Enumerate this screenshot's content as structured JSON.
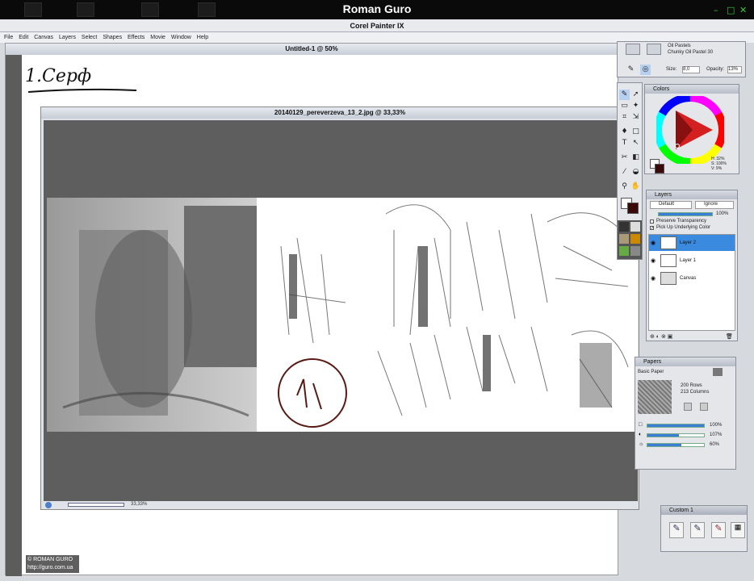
{
  "window": {
    "title": "Roman Guro",
    "controls": [
      "–",
      "□",
      "✕"
    ]
  },
  "app": {
    "title": "Corel Painter IX"
  },
  "menu": [
    "File",
    "Edit",
    "Canvas",
    "Layers",
    "Select",
    "Shapes",
    "Effects",
    "Movie",
    "Window",
    "Help"
  ],
  "doc1": {
    "title": "Untitled-1 @ 50%",
    "handwriting": "1.Серф"
  },
  "doc2": {
    "title": "20140129_pereverzeva_13_2.jpg @ 33,33%",
    "zoom": "33,33%"
  },
  "brush": {
    "category": "Oil Pastels",
    "variant": "Chunky Oil Pastel 30",
    "size_label": "Size:",
    "size": "8,0",
    "opacity_label": "Opacity:",
    "opacity": "13%"
  },
  "colors": {
    "title": "Colors",
    "readout": [
      "H: 32%",
      "S: 100%",
      "V: 9%"
    ],
    "main_color": "#3a0a08"
  },
  "layers": {
    "title": "Layers",
    "composite": "Default",
    "method": "Ignore",
    "opacity": "100%",
    "preserve": "Preserve Transparency",
    "pickup": "Pick Up Underlying Color",
    "items": [
      {
        "name": "Layer 2",
        "selected": true
      },
      {
        "name": "Layer 1",
        "selected": false
      },
      {
        "name": "Canvas",
        "selected": false
      }
    ]
  },
  "papers": {
    "title": "Papers",
    "name": "Basic Paper",
    "rows": "200 Rows",
    "cols": "213 Columns",
    "sliders": [
      {
        "value": "100%",
        "fill": 1.0
      },
      {
        "value": "107%",
        "fill": 0.55
      },
      {
        "value": "60%",
        "fill": 0.6
      }
    ]
  },
  "custom": {
    "title": "Custom 1"
  },
  "watermark": {
    "line1": "© ROMAN GURO",
    "line2": "http://guro.com.ua"
  }
}
